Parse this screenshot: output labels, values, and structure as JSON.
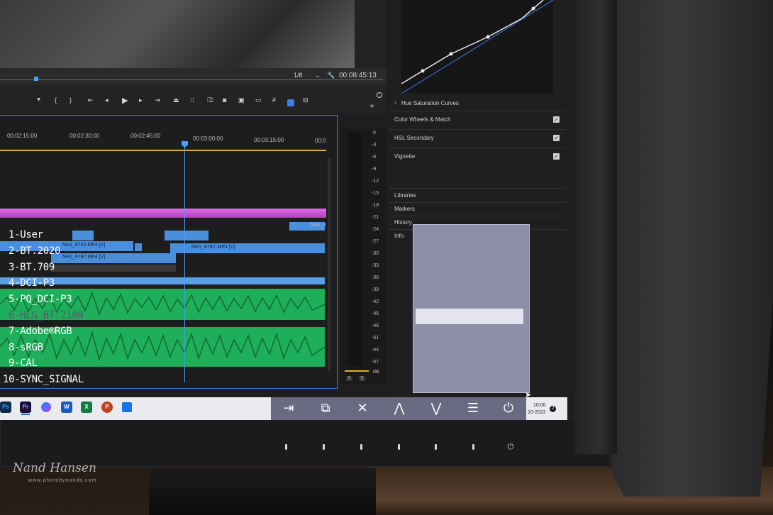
{
  "program_monitor": {
    "zoom": "1/8",
    "timecode": "00:08:45:13"
  },
  "timeline": {
    "ruler": [
      "00:02:15:00",
      "00:02:30:00",
      "00:02:45:00",
      "00:03:00:00",
      "00:03:15:00",
      "00:0"
    ],
    "clips": [
      "NH1_6703.MP4 [V]",
      "NH1_6797.MP4 [V]",
      "NH1_678C.MP4 [V]",
      "NH1_6"
    ]
  },
  "meter": {
    "scale": [
      "0",
      "-3",
      "-6",
      "-9",
      "-12",
      "-15",
      "-18",
      "-21",
      "-24",
      "-27",
      "-30",
      "-33",
      "-36",
      "-39",
      "-42",
      "-45",
      "-48",
      "-51",
      "-54",
      "-57",
      "dB"
    ],
    "solo_buttons": [
      "S",
      "S"
    ]
  },
  "lumetri_panel": {
    "sections": [
      {
        "label": "Hue Saturation Curves",
        "expander": "›"
      },
      {
        "label": "Color Wheels & Match",
        "checked": true
      },
      {
        "label": "HSL Secondary",
        "checked": true
      },
      {
        "label": "Vignette",
        "checked": true
      }
    ],
    "panels": [
      "Libraries",
      "Markers",
      "History",
      "Info"
    ]
  },
  "taskbar": {
    "apps": [
      "Ps",
      "Pr",
      "Messenger",
      "W",
      "X",
      "P",
      "Calendar"
    ],
    "clock_time": "10:00",
    "clock_date": "10-2022",
    "notification_count": "2"
  },
  "osd_menu": {
    "items": [
      "1-User",
      "2-BT.2020",
      "3-BT.709",
      "4-DCI-P3",
      "5-PQ_DCI-P3",
      "6-HLG_BT.2100",
      "7-Adobe®RGB",
      "8-sRGB",
      "9-CAL",
      "10-SYNC_SIGNAL"
    ],
    "selected_index": 5,
    "buttons": [
      "input-icon",
      "mode-icon",
      "close-icon",
      "up-icon",
      "down-icon",
      "menu-icon",
      "power-icon"
    ]
  },
  "watermark": {
    "signature": "Nand Hansen",
    "site": "www.photobynando.com"
  },
  "colors": {
    "timeline_border": "#3d7de0",
    "clip_blue": "#4a8fdc",
    "clip_magenta": "#c24bcf",
    "audio_green": "#1fae5a",
    "osd_bg": "#8e8ea8",
    "osd_selected": "#e4e4ee"
  }
}
